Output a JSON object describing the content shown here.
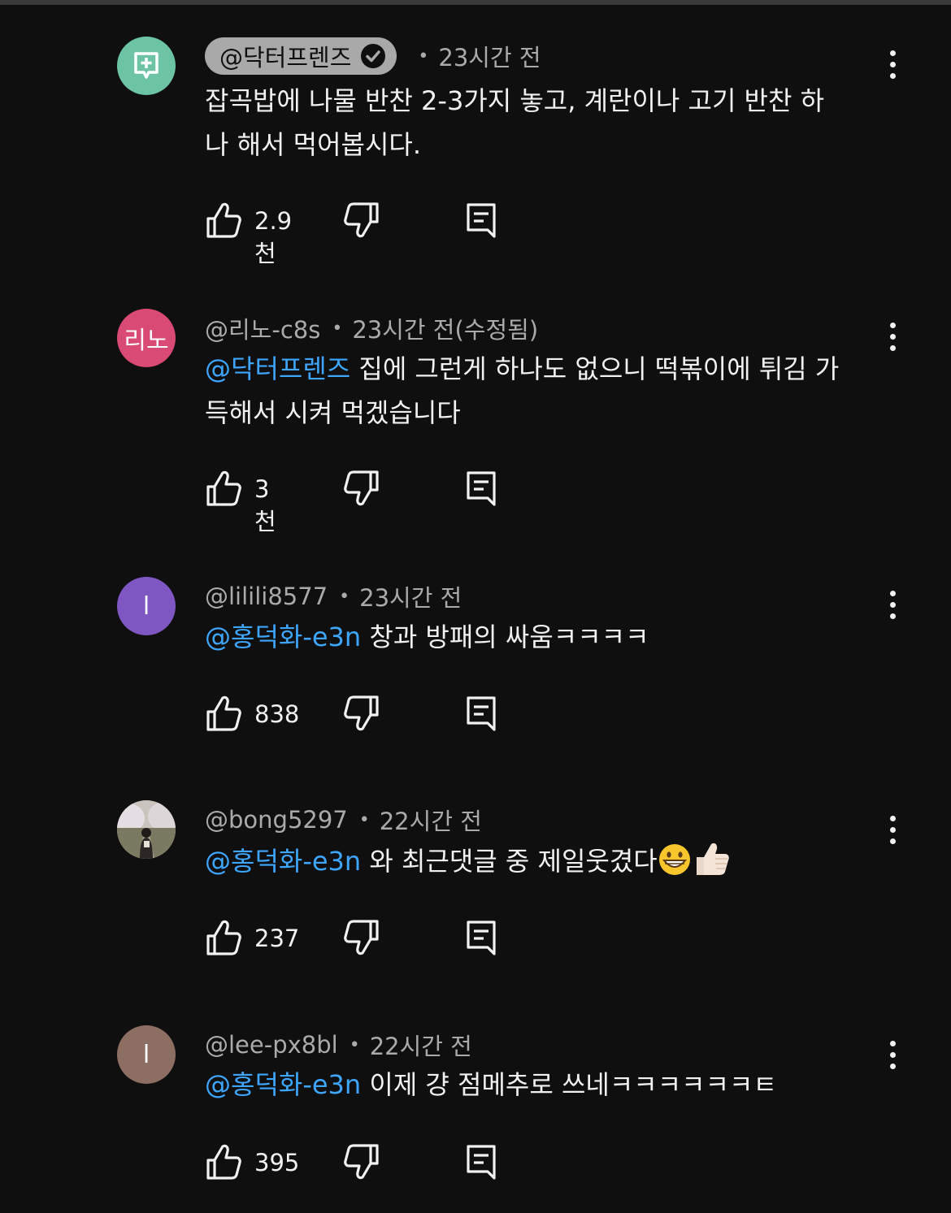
{
  "comments": [
    {
      "author": "@닥터프렌즈",
      "time": "23시간 전",
      "body_line1": "잡곡밥에 나물 반찬 2-3가지 놓고, 계란이나 고기 반찬 하",
      "body_line2": "나 해서 먹어봅시다.",
      "likes": "2.9천",
      "avatar_color": "#6cc4a4",
      "avatar_icon": "add-note-icon",
      "verified": true
    },
    {
      "author": "@리노-c8s",
      "time": "23시간 전(수정됨)",
      "mention": "@닥터프렌즈",
      "body_line1": " 집에 그런게 하나도 없으니 떡볶이에 튀김 가",
      "body_line2": "득해서 시켜 먹겠습니다",
      "likes": "3천",
      "avatar_color": "#d94a74",
      "avatar_label": "리노"
    },
    {
      "author": "@lilili8577",
      "time": "23시간 전",
      "mention": "@홍덕화-e3n",
      "body": " 창과 방패의 싸움ㅋㅋㅋㅋ",
      "likes": "838",
      "avatar_color": "#7e57c2",
      "avatar_label": "l"
    },
    {
      "author": "@bong5297",
      "time": "22시간 전",
      "mention": "@홍덕화-e3n",
      "body": " 와  최근댓글 중 제일웃겼다",
      "likes": "237",
      "avatar_photo": "blossom-path-photo"
    },
    {
      "author": "@lee-px8bl",
      "time": "22시간 전",
      "mention": "@홍덕화-e3n",
      "body": " 이제 걍 점메추로 쓰네ㅋㅋㅋㅋㅋㅋㅌ",
      "likes": "395",
      "avatar_color": "#8d6e63",
      "avatar_label": "l"
    }
  ],
  "theme": {
    "background": "#0f0f0f",
    "mention": "#3ea6ff",
    "meta": "#aaaaaa"
  }
}
